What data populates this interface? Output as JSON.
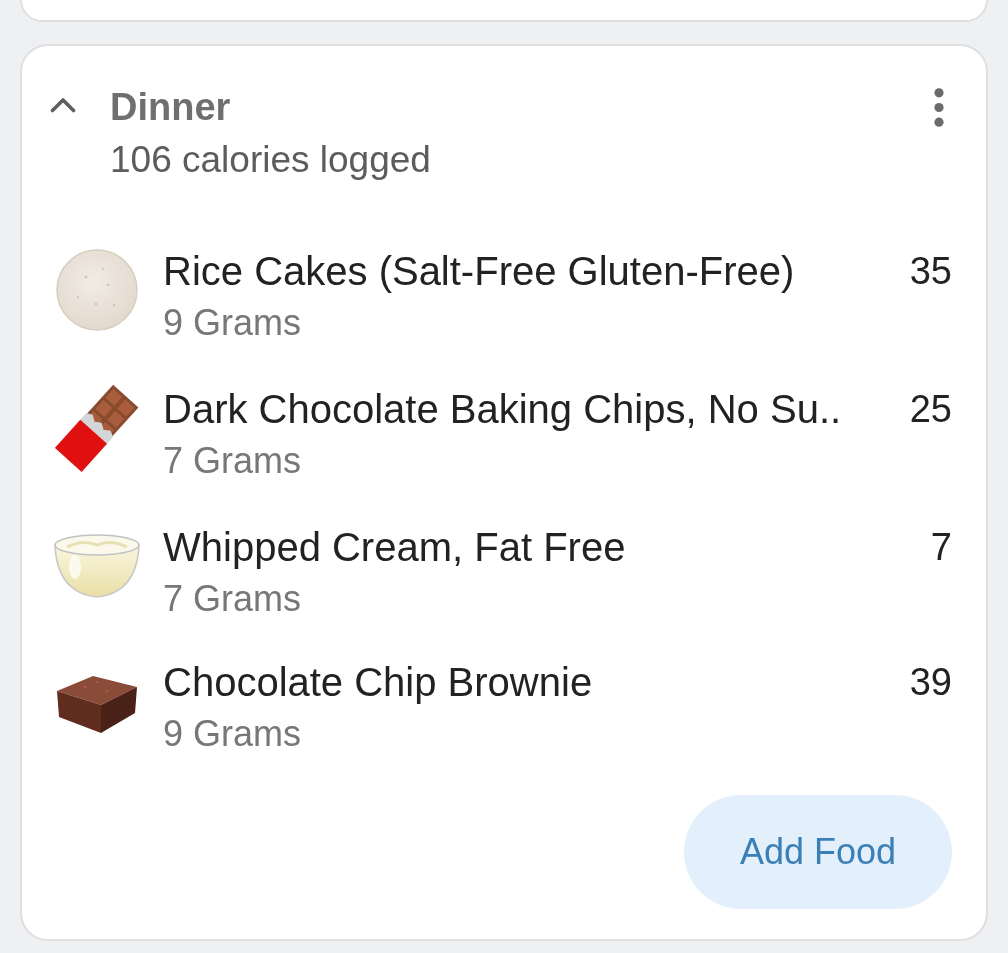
{
  "meal": {
    "title": "Dinner",
    "subtitle": "106 calories logged",
    "expanded": true
  },
  "foods": [
    {
      "kind": "rice_cake",
      "name": "Rice Cakes (Salt-Free Gluten-Free)",
      "serving": "9 Grams",
      "calories": "35"
    },
    {
      "kind": "chocolate_bar",
      "name": "Dark Chocolate Baking Chips, No Su..",
      "serving": "7 Grams",
      "calories": "25"
    },
    {
      "kind": "cream_bowl",
      "name": "Whipped Cream, Fat Free",
      "serving": "7 Grams",
      "calories": "7"
    },
    {
      "kind": "brownie",
      "name": "Chocolate Chip Brownie",
      "serving": "9 Grams",
      "calories": "39"
    }
  ],
  "add_button": {
    "label": "Add Food"
  }
}
